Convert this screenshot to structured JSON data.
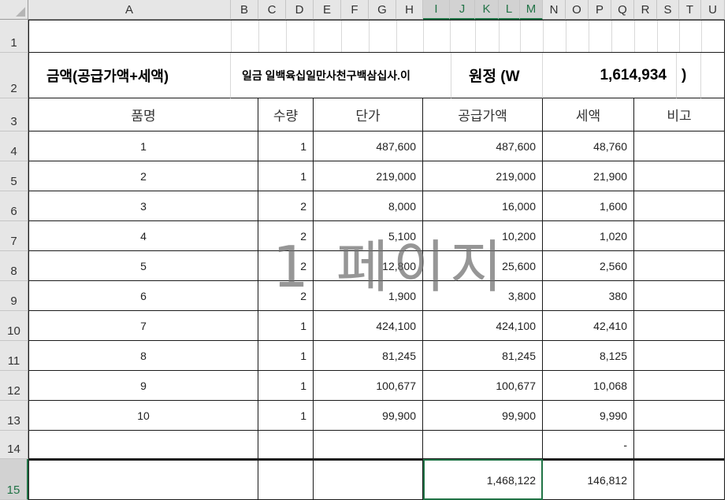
{
  "columns": [
    "A",
    "B",
    "C",
    "D",
    "E",
    "F",
    "G",
    "H",
    "I",
    "J",
    "K",
    "L",
    "M",
    "N",
    "O",
    "P",
    "Q",
    "R",
    "S",
    "T",
    "U"
  ],
  "selected_columns": [
    "I",
    "J",
    "K",
    "L",
    "M"
  ],
  "rows": [
    "1",
    "2",
    "3",
    "4",
    "5",
    "6",
    "7",
    "8",
    "9",
    "10",
    "11",
    "12",
    "13",
    "14",
    "15"
  ],
  "selected_row": "15",
  "summary": {
    "label": "금액(공급가액+세액)",
    "words": "일금  일백육십일만사천구백삼십사.이",
    "won_label": "원정 (W",
    "amount": "1,614,934",
    "close": ")"
  },
  "headers": {
    "name": "품명",
    "qty": "수량",
    "price": "단가",
    "supply": "공급가액",
    "tax": "세액",
    "note": "비고"
  },
  "items": [
    {
      "name": "1",
      "qty": "1",
      "price": "487,600",
      "supply": "487,600",
      "tax": "48,760"
    },
    {
      "name": "2",
      "qty": "1",
      "price": "219,000",
      "supply": "219,000",
      "tax": "21,900"
    },
    {
      "name": "3",
      "qty": "2",
      "price": "8,000",
      "supply": "16,000",
      "tax": "1,600"
    },
    {
      "name": "4",
      "qty": "2",
      "price": "5,100",
      "supply": "10,200",
      "tax": "1,020"
    },
    {
      "name": "5",
      "qty": "2",
      "price": "12,800",
      "supply": "25,600",
      "tax": "2,560"
    },
    {
      "name": "6",
      "qty": "2",
      "price": "1,900",
      "supply": "3,800",
      "tax": "380"
    },
    {
      "name": "7",
      "qty": "1",
      "price": "424,100",
      "supply": "424,100",
      "tax": "42,410"
    },
    {
      "name": "8",
      "qty": "1",
      "price": "81,245",
      "supply": "81,245",
      "tax": "8,125"
    },
    {
      "name": "9",
      "qty": "1",
      "price": "100,677",
      "supply": "100,677",
      "tax": "10,068"
    },
    {
      "name": "10",
      "qty": "1",
      "price": "99,900",
      "supply": "99,900",
      "tax": "9,990"
    }
  ],
  "row14": {
    "tax": "-"
  },
  "totals": {
    "supply": "1,468,122",
    "tax": "146,812"
  },
  "watermark": "1 페이지",
  "colors": {
    "accent": "#217346",
    "header_bg": "#e6e6e6"
  }
}
